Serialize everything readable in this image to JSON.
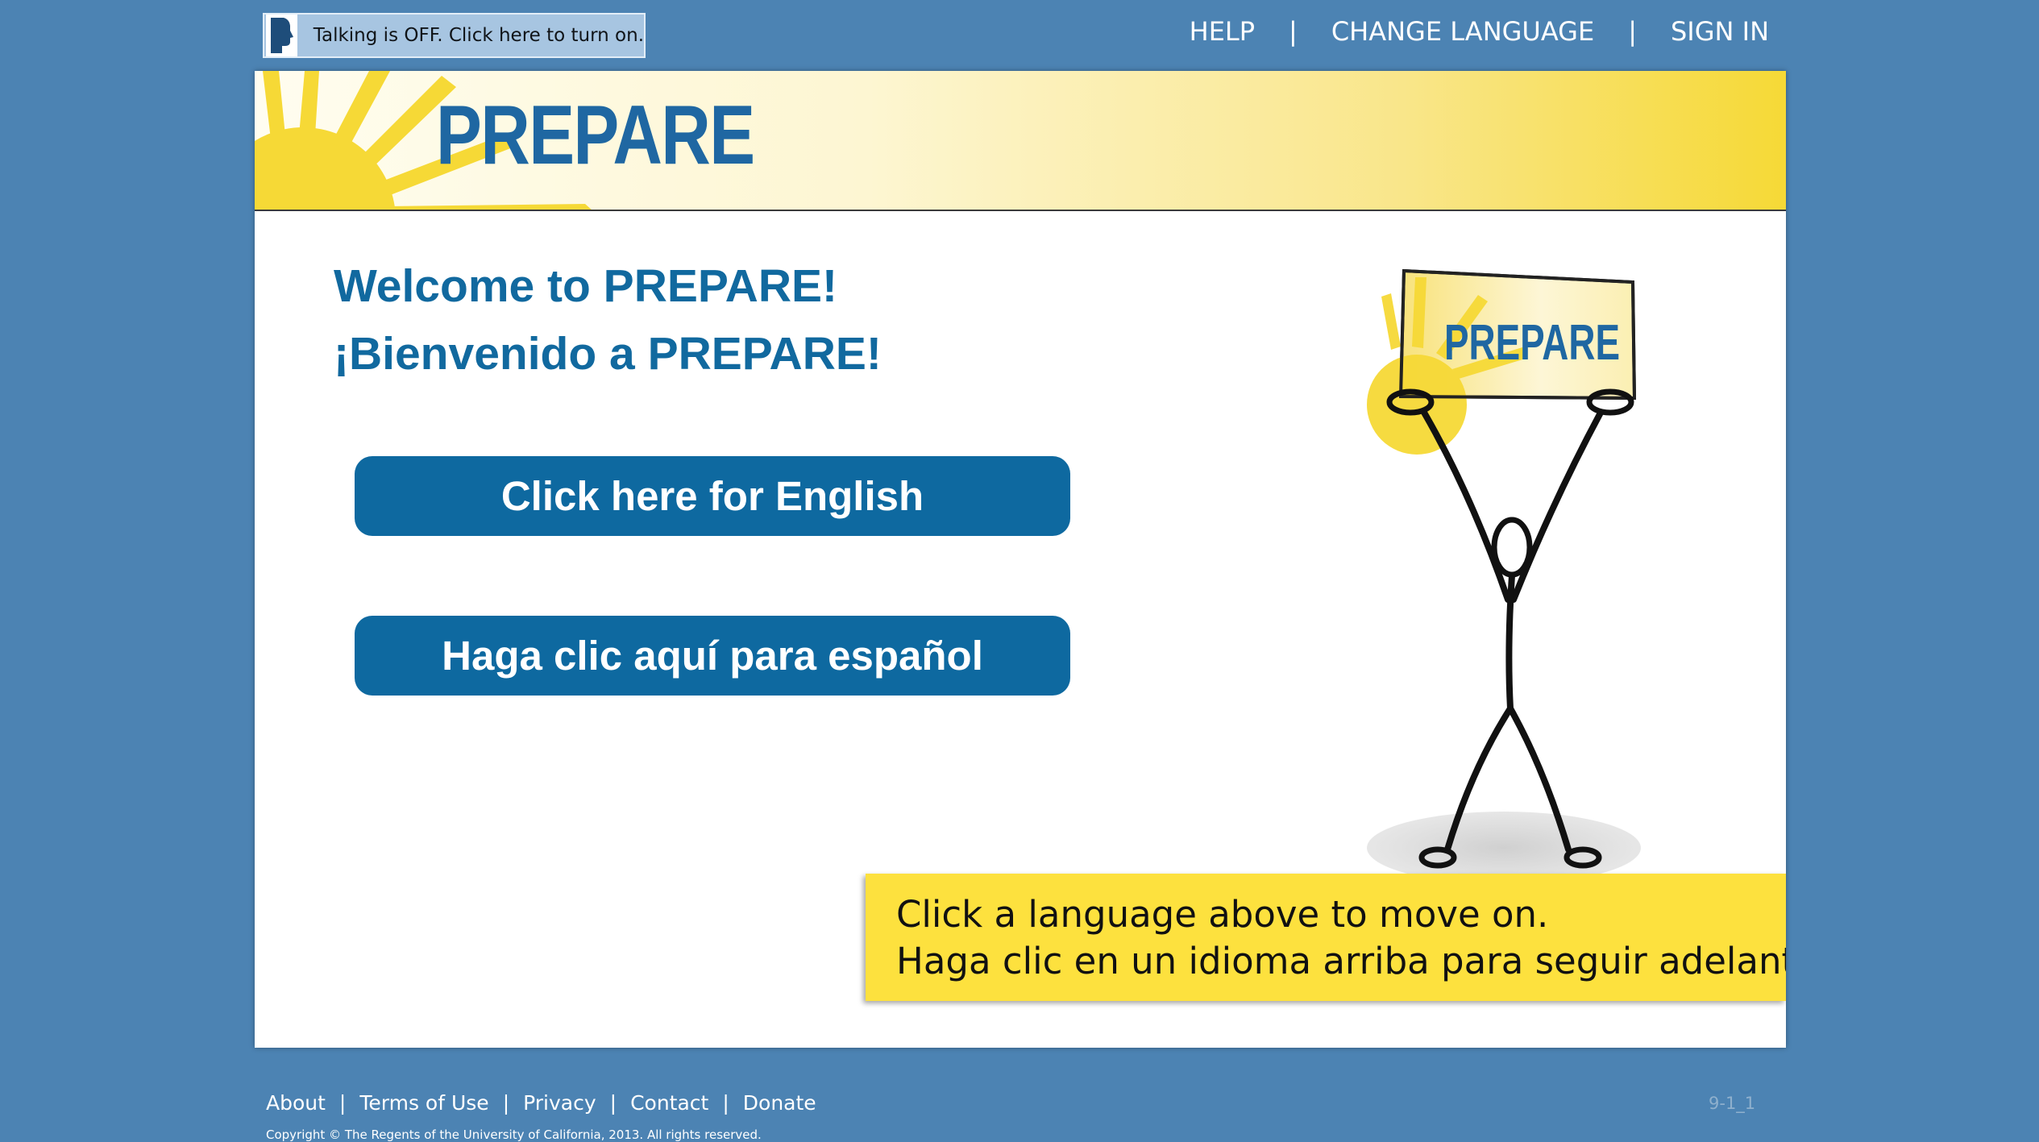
{
  "talk_toggle": {
    "label": "Talking is OFF. Click here to turn on.",
    "icon": "speaking-head-icon"
  },
  "topnav": {
    "help": "HELP",
    "separator": "|",
    "change_language": "CHANGE LANGUAGE",
    "sign_in": "SIGN IN"
  },
  "banner": {
    "logo_text": "PREPARE"
  },
  "welcome": {
    "english": "Welcome to PREPARE!",
    "spanish": "¡Bienvenido a PREPARE!"
  },
  "buttons": {
    "english": "Click here for English",
    "spanish": "Haga clic aquí para español"
  },
  "mascot": {
    "sign_text": "PREPARE"
  },
  "notice": {
    "line1": "Click a language above to move on.",
    "line2": "Haga clic en un idioma arriba para seguir adelante."
  },
  "footer": {
    "about": "About",
    "terms": "Terms of Use",
    "privacy": "Privacy",
    "contact": "Contact",
    "donate": "Donate",
    "separator": "|",
    "page_code": "9-1_1",
    "copyright": "Copyright © The Regents of the University of California, 2013. All rights reserved."
  },
  "colors": {
    "background": "#4c83b3",
    "button": "#0e69a0",
    "heading": "#11699f",
    "notice": "#fde13e",
    "banner_gold": "#f6d936"
  }
}
